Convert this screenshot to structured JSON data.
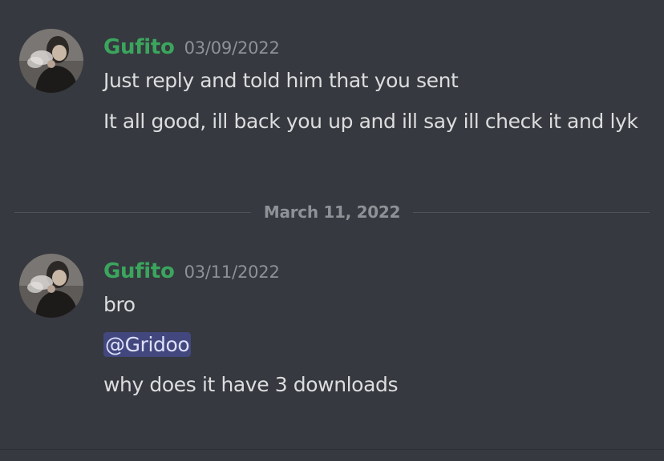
{
  "colors": {
    "background": "#36393f",
    "username": "#3ba55d",
    "text": "#dcddde",
    "timestamp": "#8e9297",
    "mention_bg": "#4f5aa8"
  },
  "messages": [
    {
      "author": "Gufito",
      "timestamp": "03/09/2022",
      "avatar_icon": "user-avatar-icon",
      "lines": [
        "Just reply and told him that you sent",
        "It all good, ill back you up and ill say ill check it and lyk"
      ]
    },
    {
      "author": "Gufito",
      "timestamp": "03/11/2022",
      "avatar_icon": "user-avatar-icon",
      "lines": [
        "bro",
        "@Gridoo",
        "why does it have 3 downloads"
      ]
    }
  ],
  "date_divider": {
    "label": "March 11, 2022"
  }
}
